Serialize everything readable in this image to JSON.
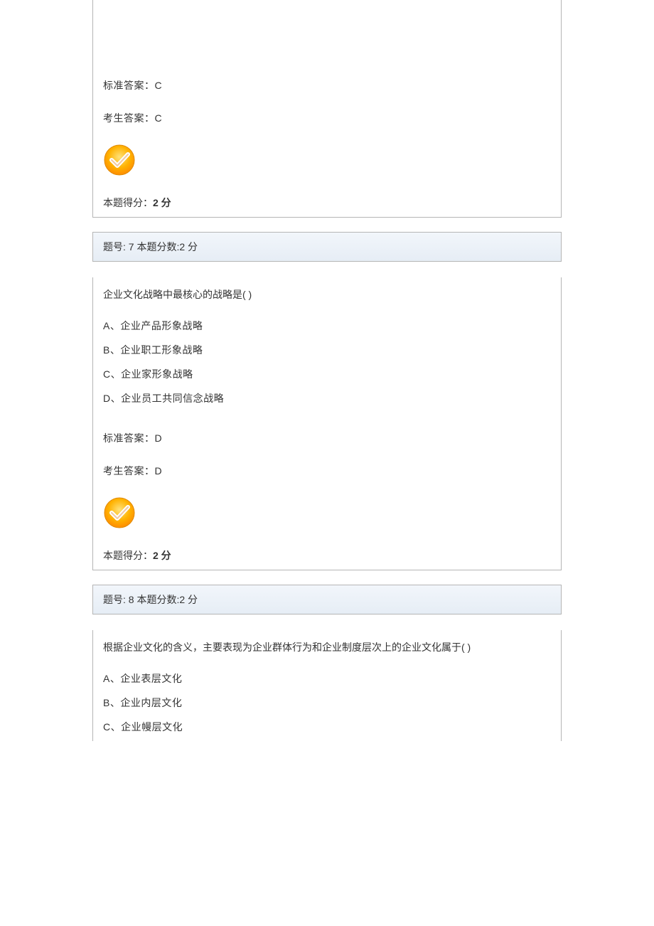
{
  "q6_tail": {
    "std_answer_label": "标准答案：",
    "std_answer_value": "C",
    "user_answer_label": "考生答案：",
    "user_answer_value": "C",
    "score_label": "本题得分：",
    "score_value": "2 分"
  },
  "q7": {
    "header": "题号: 7  本题分数:2 分",
    "question": "企业文化战略中最核心的战略是( )",
    "options": {
      "A": "A、企业产品形象战略",
      "B": "B、企业职工形象战略",
      "C": "C、企业家形象战略",
      "D": "D、企业员工共同信念战略"
    },
    "std_answer_label": "标准答案：",
    "std_answer_value": "D",
    "user_answer_label": "考生答案：",
    "user_answer_value": "D",
    "score_label": "本题得分：",
    "score_value": "2 分"
  },
  "q8": {
    "header": "题号: 8  本题分数:2 分",
    "question": "根据企业文化的含义，主要表现为企业群体行为和企业制度层次上的企业文化属于( )",
    "options": {
      "A": "A、企业表层文化",
      "B": "B、企业内层文化",
      "C": "C、企业幔层文化"
    }
  }
}
